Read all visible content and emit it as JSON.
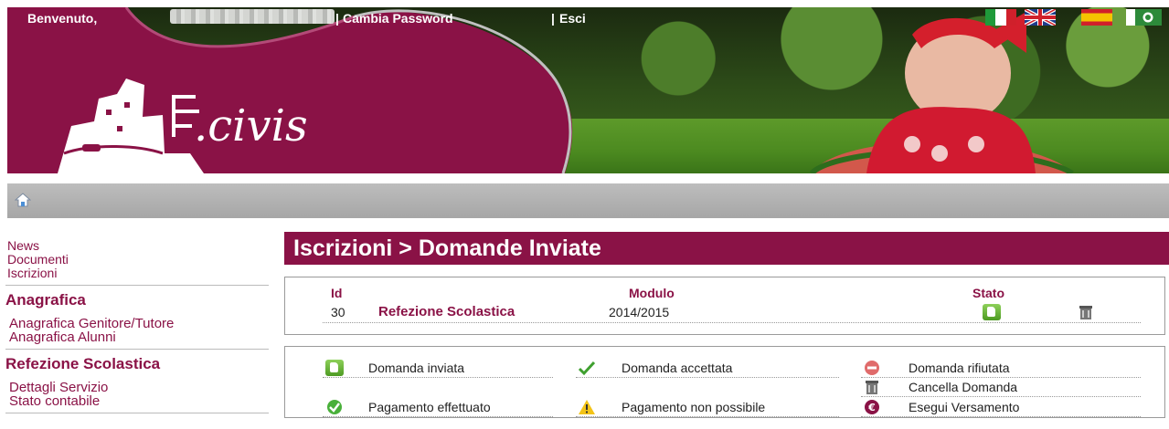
{
  "app": {
    "brand_text": ".civis",
    "colors": {
      "accent": "#8a1246",
      "topbar": "#aeaeae",
      "text": "#222222"
    }
  },
  "topbar": {
    "greeting": "Benvenuto,",
    "separator": "|",
    "change_password": "Cambia Password",
    "logout": "Esci",
    "home_icon": "home-icon",
    "flags": [
      "flag-italy-icon",
      "flag-uk-icon",
      "flag-spain-icon",
      "flag-other-icon"
    ]
  },
  "sidebar": {
    "top_links": [
      "News",
      "Documenti",
      "Iscrizioni"
    ],
    "sections": [
      {
        "title": "Anagrafica",
        "items": [
          "Anagrafica Genitore/Tutore",
          "Anagrafica Alunni"
        ]
      },
      {
        "title": "Refezione Scolastica",
        "items": [
          "Dettagli Servizio",
          "Stato contabile"
        ]
      }
    ]
  },
  "main": {
    "title": "Iscrizioni > Domande Inviate",
    "table": {
      "headers": {
        "id": "Id",
        "modulo": "Modulo",
        "stato": "Stato"
      },
      "rows": [
        {
          "id": "30",
          "servizio": "Refezione Scolastica",
          "anno": "2014/2015",
          "stato_icon": "thumbs-up-icon",
          "action_icon": "trash-icon"
        }
      ]
    },
    "legend": [
      {
        "icon": "thumbs-up-icon",
        "label": "Domanda inviata"
      },
      {
        "icon": "checkmark-icon",
        "label": "Domanda accettata"
      },
      {
        "icon": "no-entry-icon",
        "label": "Domanda rifiutata"
      },
      {
        "icon": "trash-icon",
        "label": "Cancella Domanda"
      },
      {
        "icon": "check-circle-icon",
        "label": "Pagamento effettuato"
      },
      {
        "icon": "warning-icon",
        "label": "Pagamento non possibile"
      },
      {
        "icon": "euro-icon",
        "label": "Esegui Versamento"
      }
    ]
  }
}
